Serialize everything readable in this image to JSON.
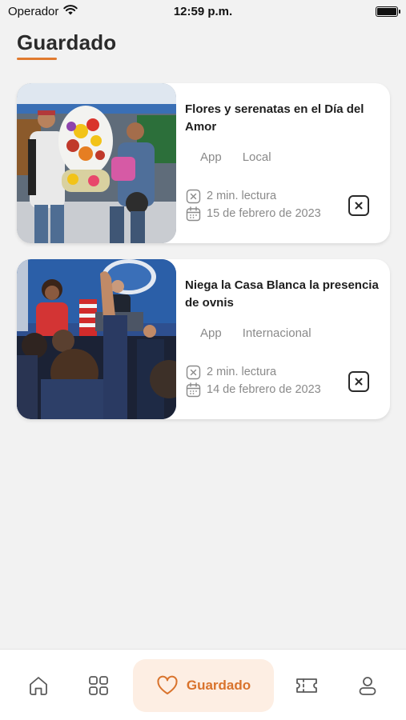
{
  "status_bar": {
    "carrier": "Operador",
    "time": "12:59 p.m."
  },
  "page": {
    "title": "Guardado"
  },
  "colors": {
    "accent": "#e07a2f",
    "active_tab_bg": "#fdeee3",
    "background": "#f2f2f2"
  },
  "articles": [
    {
      "title": "Flores y serenatas en el Día del Amor",
      "tags": [
        "App",
        "Local"
      ],
      "reading_time": "2 min. lectura",
      "date": "15 de febrero de 2023",
      "image": "flower-vendors-photo"
    },
    {
      "title": "Niega la Casa Blanca la presencia de ovnis",
      "tags": [
        "App",
        "Internacional"
      ],
      "reading_time": "2 min. lectura",
      "date": "14 de febrero de 2023",
      "image": "white-house-briefing-photo"
    }
  ],
  "tab_bar": {
    "items": [
      "home-icon",
      "grid-icon",
      "heart-icon",
      "ticket-icon",
      "user-icon"
    ],
    "active_label": "Guardado"
  }
}
